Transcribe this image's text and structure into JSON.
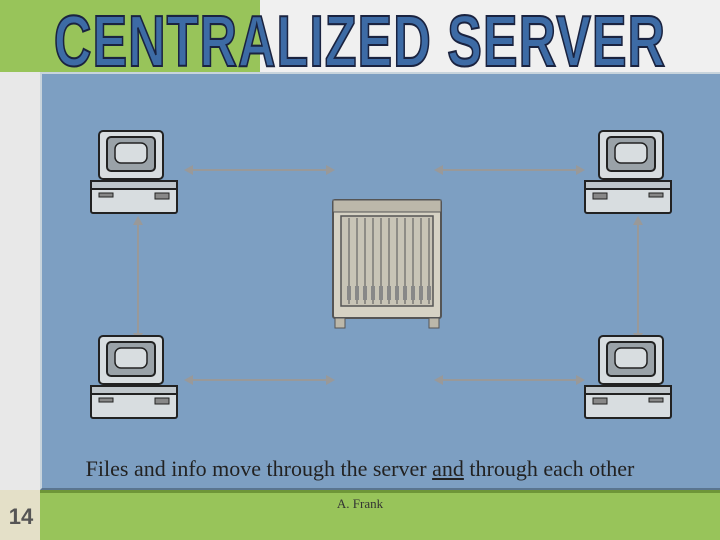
{
  "title": "CENTRALIZED SERVER",
  "caption_part1": "Files and info move through the server ",
  "caption_und": "and",
  "caption_part2": " through each other",
  "author": "A. Frank",
  "slide_number": "14",
  "nodes": {
    "tl": "client-computer",
    "tr": "client-computer",
    "bl": "client-computer",
    "br": "client-computer",
    "center": "server-rack"
  }
}
